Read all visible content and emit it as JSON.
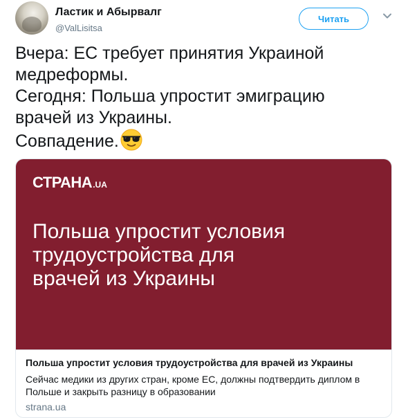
{
  "author": {
    "name": "Ластик и Абырвалг",
    "handle": "@ValLisitsa"
  },
  "follow_button": {
    "label": "Читать"
  },
  "tweet": {
    "lines": [
      "Вчера: ЕС требует принятия Украиной",
      "медреформы.",
      "Сегодня: Польша упростит эмиграцию",
      "врачей из Украины.",
      "Совпадение."
    ],
    "emoji": "smiling-face-with-sunglasses"
  },
  "card": {
    "image": {
      "brand": "СТРАНА",
      "brand_suffix": ".UA",
      "headline_lines": [
        "Польша упростит условия",
        "трудоустройства для",
        "врачей из Украины"
      ],
      "background_color": "#821e2f"
    },
    "title": "Польша упростит условия трудоустройства для врачей из Украины",
    "description_lines": [
      "Сейчас медики из других стран, кроме ЕС, должны подтвердить диплом в",
      "Польше и закрыть разницу в образовании"
    ],
    "domain": "strana.ua"
  },
  "colors": {
    "accent": "#1da1f2",
    "text": "#14171a",
    "secondary_text": "#657786",
    "card_border": "#e1e8ed"
  },
  "icons": {
    "menu": "chevron-down-icon"
  }
}
